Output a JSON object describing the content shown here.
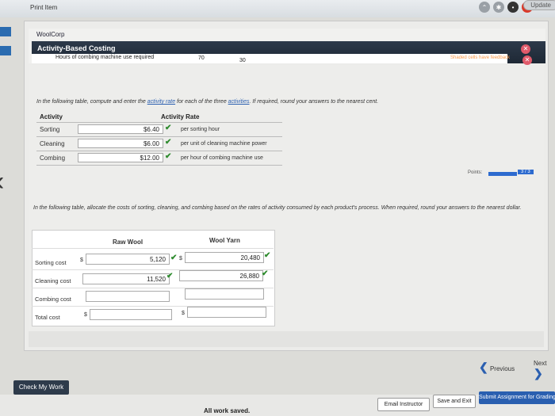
{
  "window": {
    "title": "Print Item",
    "update_label": "Update"
  },
  "header": {
    "company": "WoolCorp",
    "section_title": "Activity-Based Costing",
    "subrow_label": "Hours of combing machine use required",
    "subrow_value_1": "70",
    "subrow_value_2": "30",
    "feedback_note": "Shaded cells have feedback"
  },
  "rate_table": {
    "instruction_prefix": "In the following table, compute and enter the ",
    "instruction_link1": "activity rate",
    "instruction_mid": " for each of the three ",
    "instruction_link2": "activities",
    "instruction_suffix": ". If required, round your answers to the nearest cent.",
    "col_activity": "Activity",
    "col_rate": "Activity Rate",
    "rows": [
      {
        "activity": "Sorting",
        "rate": "$6.40",
        "unit": "per sorting hour"
      },
      {
        "activity": "Cleaning",
        "rate": "$6.00",
        "unit": "per unit of cleaning machine power"
      },
      {
        "activity": "Combing",
        "rate": "$12.00",
        "unit": "per hour of combing machine use"
      }
    ]
  },
  "points": {
    "label": "Points:",
    "value": "3 / 3"
  },
  "allocation": {
    "instruction": "In the following table, allocate the costs of sorting, cleaning, and combing based on the rates of activity consumed by each product's process. When required, round your answers to the nearest dollar.",
    "col_raw": "Raw Wool",
    "col_yarn": "Wool Yarn",
    "dollar": "$",
    "rows": [
      {
        "label": "Sorting cost",
        "raw": "5,120",
        "yarn": "20,480"
      },
      {
        "label": "Cleaning cost",
        "raw": "11,520",
        "yarn": "26,880"
      },
      {
        "label": "Combing cost",
        "raw": "",
        "yarn": ""
      },
      {
        "label": "Total cost",
        "raw": "",
        "yarn": ""
      }
    ]
  },
  "nav": {
    "previous": "Previous",
    "next": "Next"
  },
  "footer": {
    "check_my_work": "Check My Work",
    "status": "All work saved.",
    "email_instructor": "Email Instructor",
    "save_and_exit": "Save and Exit",
    "submit": "Submit Assignment for Grading"
  }
}
